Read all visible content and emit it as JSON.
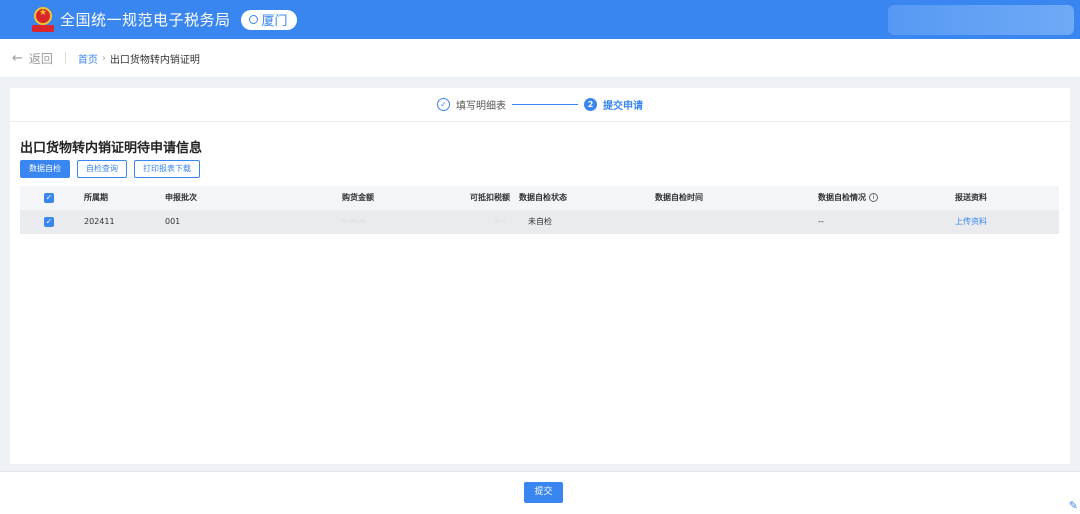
{
  "header": {
    "title": "全国统一规范电子税务局",
    "city": "厦门"
  },
  "breadcrumb": {
    "back_label": "返回",
    "home": "首页",
    "current": "出口货物转内销证明"
  },
  "steps": [
    {
      "label": "填写明细表",
      "icon": "check-icon",
      "status": "done"
    },
    {
      "label": "提交申请",
      "number": "2",
      "status": "active"
    }
  ],
  "section": {
    "title": "出口货物转内销证明待申请信息"
  },
  "buttons": {
    "data_check": "数据自检",
    "check_query": "自检查询",
    "print_download": "打印报表下载"
  },
  "table": {
    "columns": [
      "所属期",
      "申报批次",
      "购货金额",
      "可抵扣税额",
      "数据自检状态",
      "数据自检时间",
      "数据自检情况",
      "报送资料"
    ],
    "rows": [
      {
        "period": "202411",
        "batch": "001",
        "purchase_amount": "",
        "deductible_tax": "",
        "check_status": "未自检",
        "check_time": "",
        "check_situation": "--",
        "materials": "上传资料"
      }
    ]
  },
  "footer": {
    "submit_label": "提交"
  },
  "colors": {
    "accent": "#3a86f0"
  }
}
